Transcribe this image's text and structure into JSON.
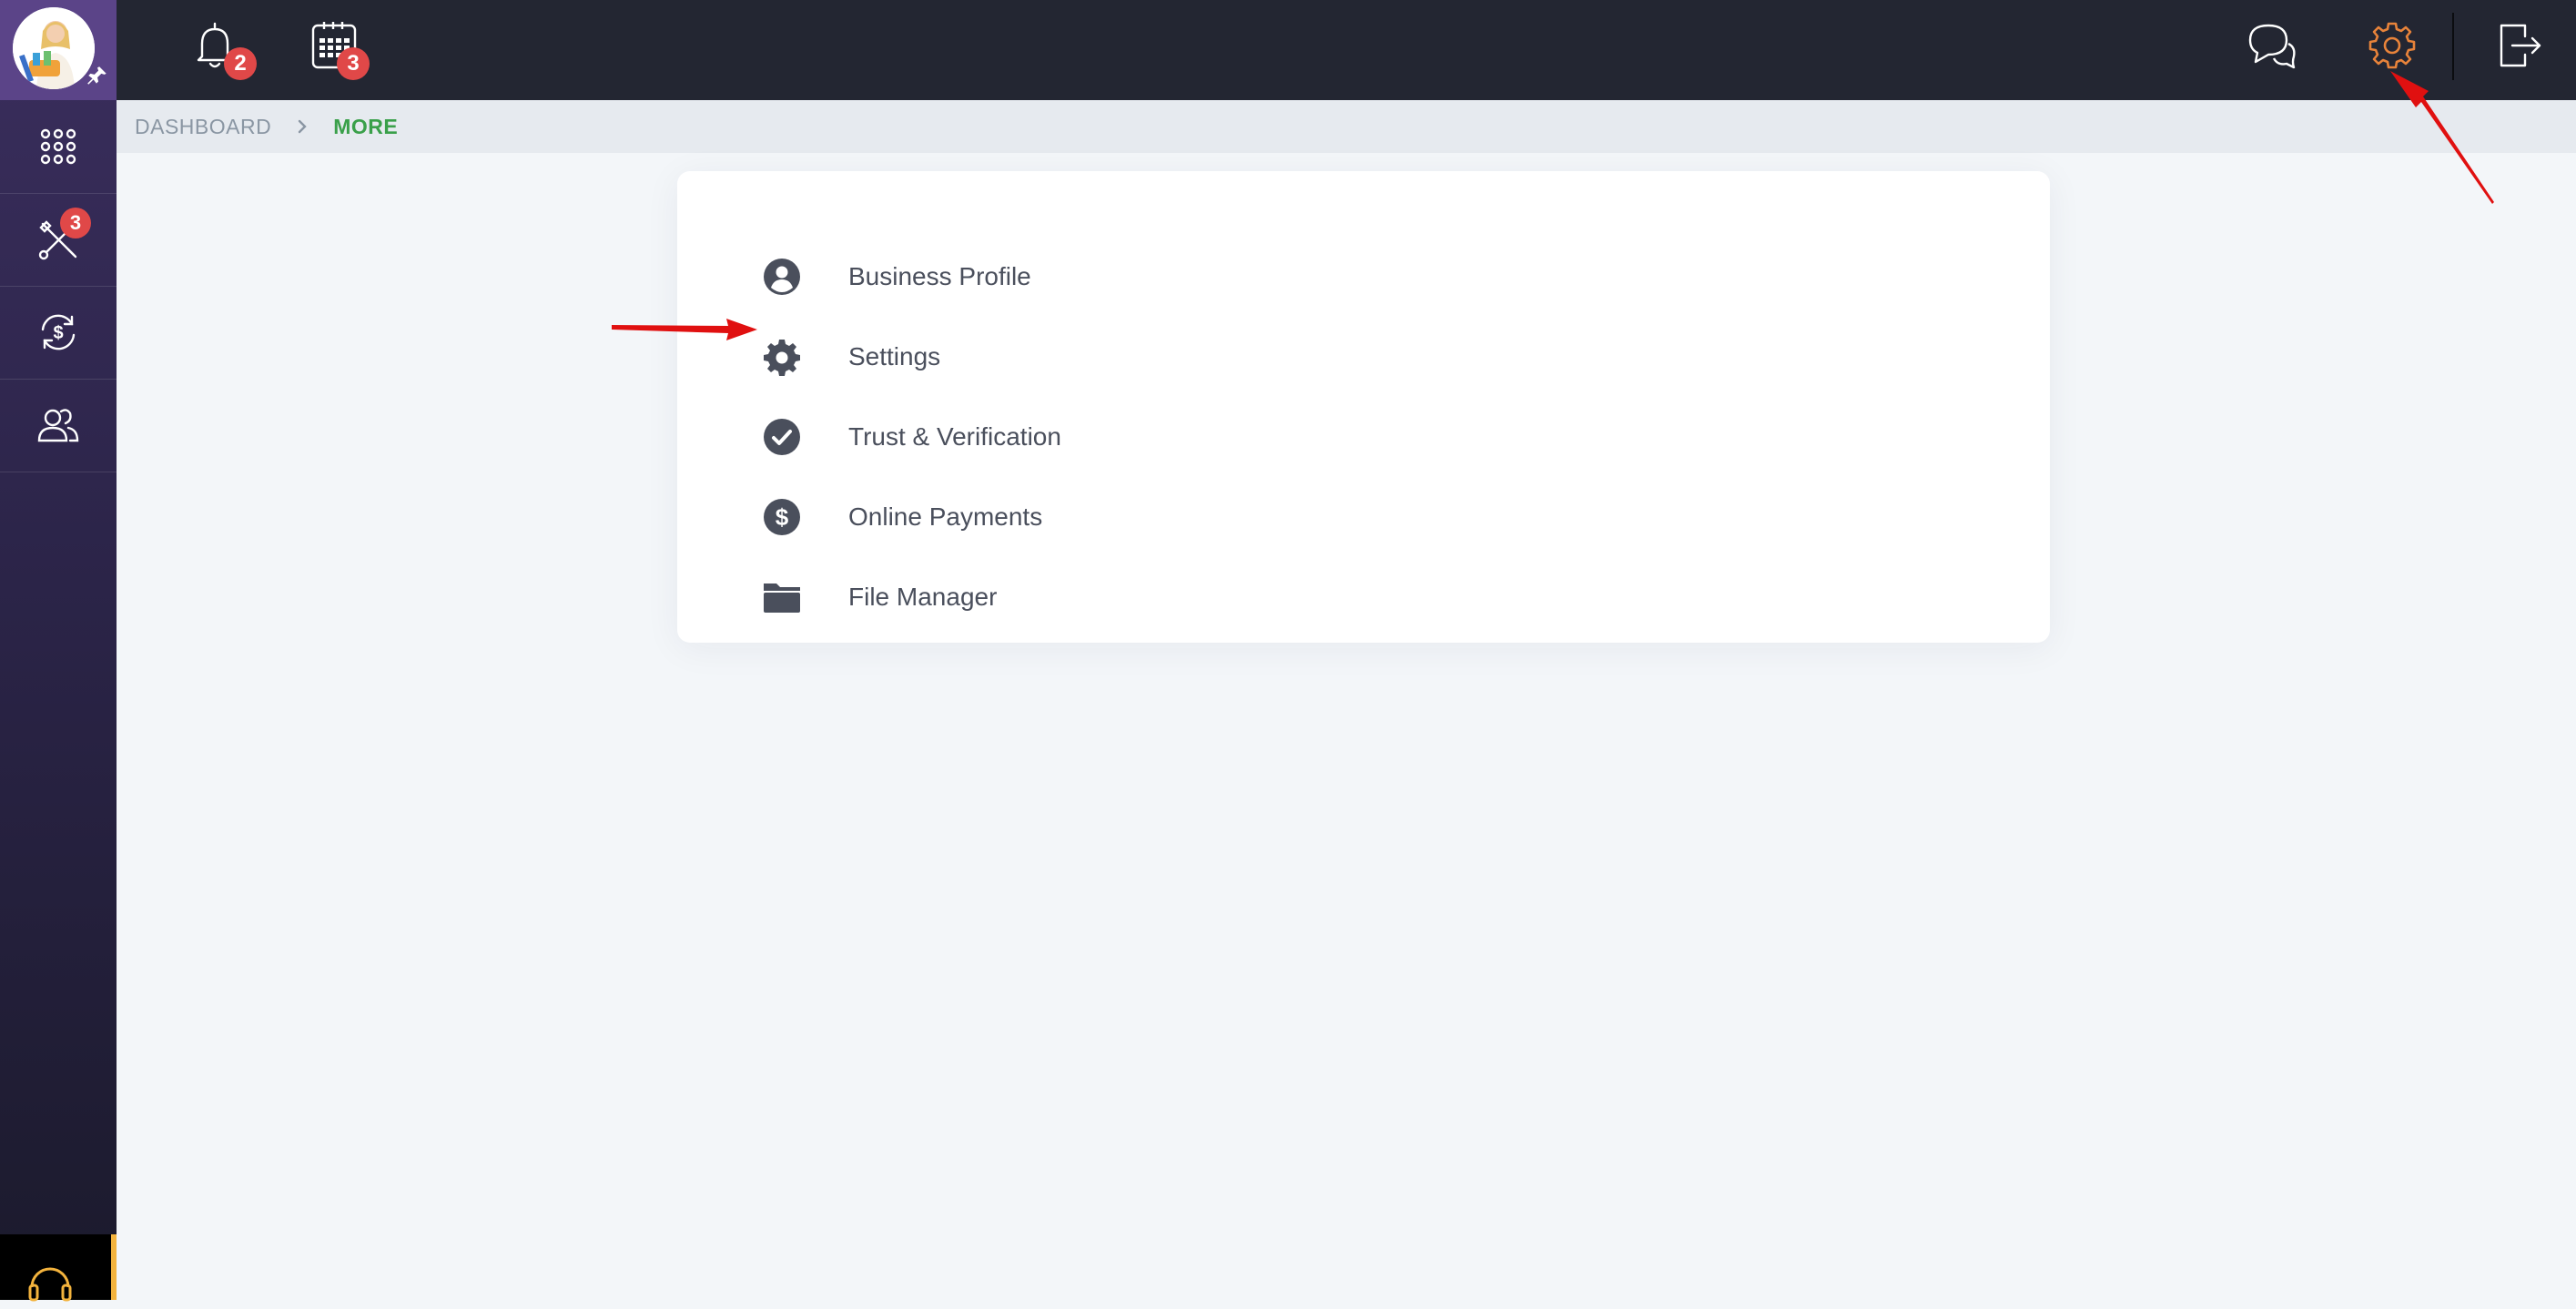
{
  "topbar": {
    "notifications_count": "2",
    "calendar_count": "3"
  },
  "sidebar": {
    "tools_badge": "3",
    "items": [
      {
        "icon": "apps-grid-icon"
      },
      {
        "icon": "tools-icon"
      },
      {
        "icon": "dollar-refresh-icon"
      },
      {
        "icon": "users-icon"
      }
    ]
  },
  "breadcrumb": {
    "items": [
      "DASHBOARD",
      "MORE"
    ]
  },
  "menu": {
    "items": [
      {
        "label": "Business Profile",
        "icon": "user-circle-icon"
      },
      {
        "label": "Settings",
        "icon": "gear-icon"
      },
      {
        "label": "Trust & Verification",
        "icon": "check-circle-icon"
      },
      {
        "label": "Online Payments",
        "icon": "dollar-circle-icon"
      },
      {
        "label": "File Manager",
        "icon": "folder-icon"
      }
    ]
  },
  "colors": {
    "topbar": "#232632",
    "sidebar": "#2b2448",
    "accent_green": "#3aa04a",
    "badge_red": "#e04848",
    "settings_orange": "#e8833a",
    "annotation_red": "#e01010"
  }
}
